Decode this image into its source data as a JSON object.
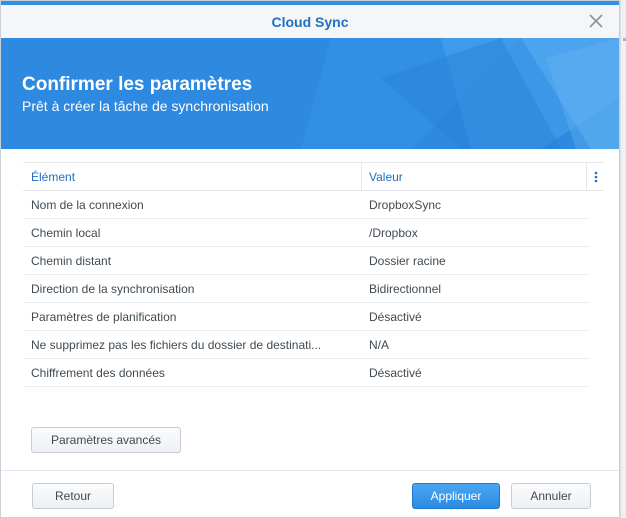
{
  "window": {
    "title": "Cloud Sync"
  },
  "banner": {
    "title": "Confirmer les paramètres",
    "subtitle": "Prêt à créer la tâche de synchronisation"
  },
  "grid": {
    "headers": [
      "Élément",
      "Valeur"
    ],
    "rows": [
      {
        "item": "Nom de la connexion",
        "value": "DropboxSync"
      },
      {
        "item": "Chemin local",
        "value": "/Dropbox"
      },
      {
        "item": "Chemin distant",
        "value": "Dossier racine"
      },
      {
        "item": "Direction de la synchronisation",
        "value": "Bidirectionnel"
      },
      {
        "item": "Paramètres de planification",
        "value": "Désactivé"
      },
      {
        "item": "Ne supprimez pas les fichiers du dossier de destinati...",
        "value": "N/A"
      },
      {
        "item": "Chiffrement des données",
        "value": "Désactivé"
      }
    ]
  },
  "buttons": {
    "advanced": "Paramètres avancés",
    "back": "Retour",
    "apply": "Appliquer",
    "cancel": "Annuler"
  },
  "colors": {
    "accent": "#2f8fe0",
    "banner": "#2d8ae0",
    "link": "#1f6fc2"
  },
  "icons": {
    "close": "close-icon",
    "columns": "column-menu-icon"
  }
}
